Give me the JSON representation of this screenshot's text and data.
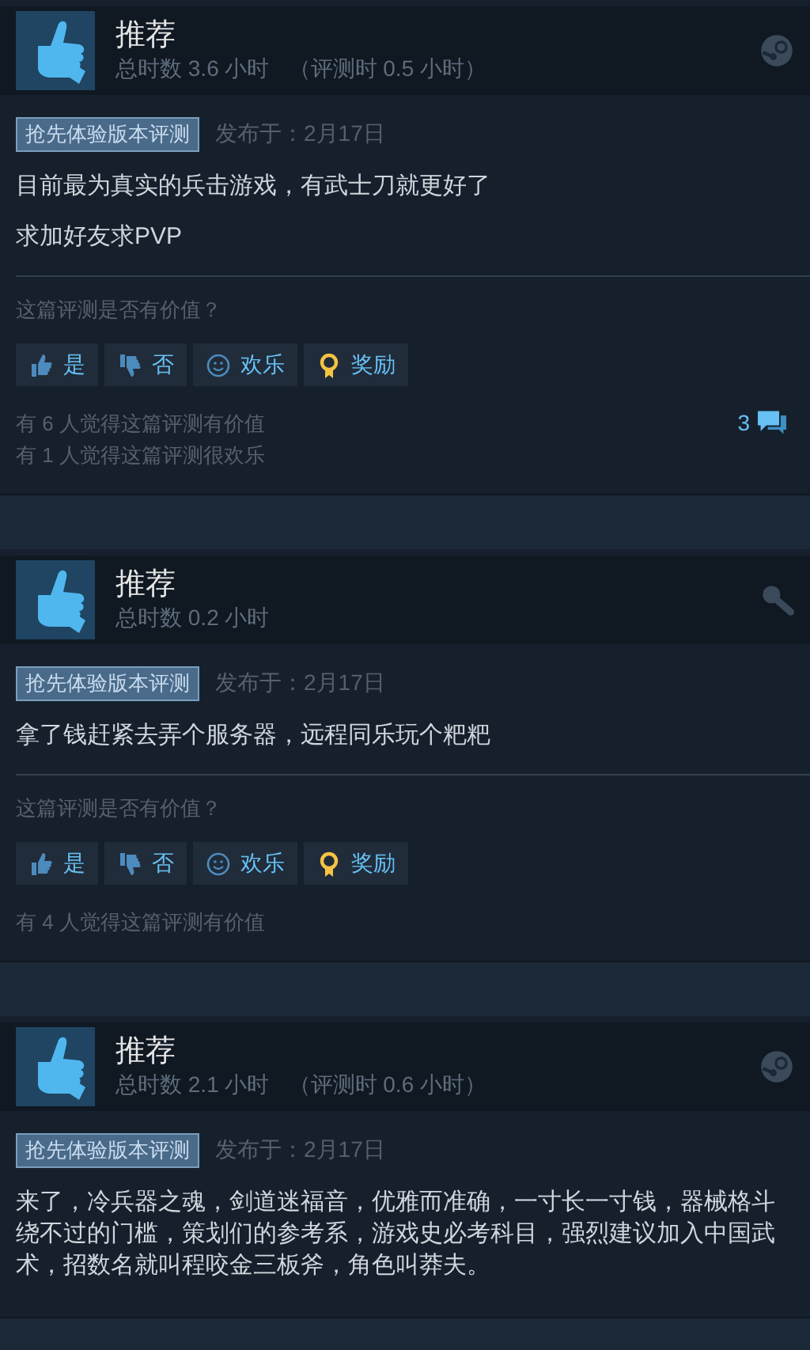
{
  "reviews": [
    {
      "verdict": "推荐",
      "hours": "总时数 3.6 小时",
      "review_hours": "（评测时 0.5 小时）",
      "kind": "steam",
      "tag": "抢先体验版本评测",
      "posted": "发布于：2月17日",
      "paragraphs": [
        "目前最为真实的兵击游戏，有武士刀就更好了",
        "求加好友求PVP"
      ],
      "prompt": "这篇评测是否有价值？",
      "votes": [
        {
          "kind": "yes",
          "label": "是"
        },
        {
          "kind": "no",
          "label": "否"
        },
        {
          "kind": "funny",
          "label": "欢乐"
        },
        {
          "kind": "award",
          "label": "奖励"
        }
      ],
      "stats": [
        "有 6 人觉得这篇评测有价值",
        "有 1 人觉得这篇评测很欢乐"
      ],
      "comments": "3"
    },
    {
      "verdict": "推荐",
      "hours": "总时数 0.2 小时",
      "kind": "key",
      "tag": "抢先体验版本评测",
      "posted": "发布于：2月17日",
      "paragraphs": [
        "拿了钱赶紧去弄个服务器，远程同乐玩个粑粑"
      ],
      "prompt": "这篇评测是否有价值？",
      "votes": [
        {
          "kind": "yes",
          "label": "是"
        },
        {
          "kind": "no",
          "label": "否"
        },
        {
          "kind": "funny",
          "label": "欢乐"
        },
        {
          "kind": "award",
          "label": "奖励"
        }
      ],
      "stats": [
        "有 4 人觉得这篇评测有价值"
      ]
    },
    {
      "verdict": "推荐",
      "hours": "总时数 2.1 小时",
      "review_hours": "（评测时 0.6 小时）",
      "kind": "steam",
      "tag": "抢先体验版本评测",
      "posted": "发布于：2月17日",
      "paragraphs": [
        "来了，冷兵器之魂，剑道迷福音，优雅而准确，一寸长一寸钱，器械格斗绕不过的门槛，策划们的参考系，游戏史必考科目，强烈建议加入中国武术，招数名就叫程咬金三板斧，角色叫莽夫。"
      ]
    }
  ]
}
